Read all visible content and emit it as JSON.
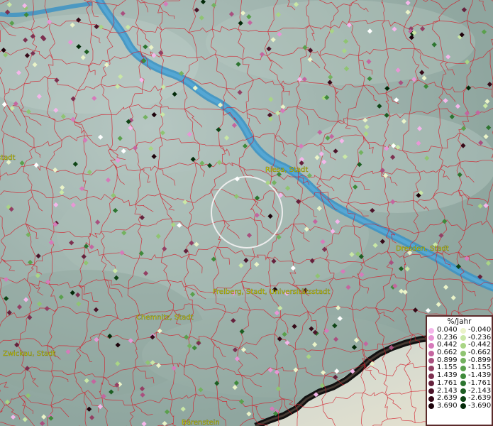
{
  "places": [
    {
      "name": "Riesa, Stadt"
    },
    {
      "name": "Dresden, Stadt"
    },
    {
      "name": "Freiberg, Stadt, Universitätsstadt"
    },
    {
      "name": "Chemnitz, Stadt"
    },
    {
      "name": "Zwickau, Stadt"
    },
    {
      "name": "Bärenstein"
    },
    {
      "name": "stadt"
    }
  ],
  "legend": {
    "title": "%/Jahr",
    "positive": [
      "0.040",
      "0.236",
      "0.442",
      "0.662",
      "0.899",
      "1.155",
      "1.439",
      "1.761",
      "2.143",
      "2.639",
      "3.690"
    ],
    "negative": [
      "-0.040",
      "-0.236",
      "-0.442",
      "-0.662",
      "-0.899",
      "-1.155",
      "-1.439",
      "-1.761",
      "-2.143",
      "-2.639",
      "-3.690"
    ],
    "positive_colors": [
      "#f4b6ea",
      "#e896d6",
      "#d67aba",
      "#c4659f",
      "#a9507f",
      "#934064",
      "#7d3050",
      "#65213c",
      "#4d1429",
      "#360a18",
      "#1d020a"
    ],
    "negative_colors": [
      "#eaf3c8",
      "#c9e7a6",
      "#a9d585",
      "#8fc472",
      "#74b260",
      "#5aa04d",
      "#3f8a3b",
      "#2d7530",
      "#1d5e22",
      "#0f4516",
      "#032a09"
    ]
  },
  "colors": {
    "river": "#3d93c4",
    "boundaries": "#d41d2a",
    "terrain": "#9fb3ad",
    "mountain_ridge": "#000000"
  }
}
